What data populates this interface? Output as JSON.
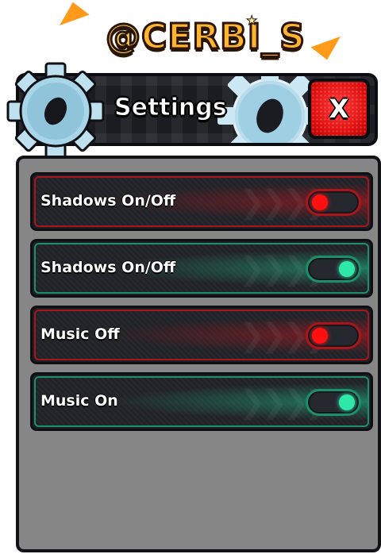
{
  "logo": {
    "text": "@CERBI_S",
    "at": "@",
    "rest": "CERBI_S"
  },
  "header": {
    "title": "Settings",
    "close_label": "X"
  },
  "settings": [
    {
      "label": "Shadows On/Off",
      "state": "off",
      "color": "#ff1010"
    },
    {
      "label": "Shadows On/Off",
      "state": "on",
      "color": "#2ee8a8"
    },
    {
      "label": "Music Off",
      "state": "off",
      "color": "#ff1010"
    },
    {
      "label": "Music On",
      "state": "on",
      "color": "#2ee8a8"
    }
  ],
  "icons": {
    "header_gear": "gear-icon",
    "close": "close-icon"
  },
  "colors": {
    "panel_bg": "#868686",
    "off_accent": "#ff1010",
    "on_accent": "#2ee8a8",
    "close_bg": "#e01010",
    "logo_orange": "#ffb52e"
  }
}
